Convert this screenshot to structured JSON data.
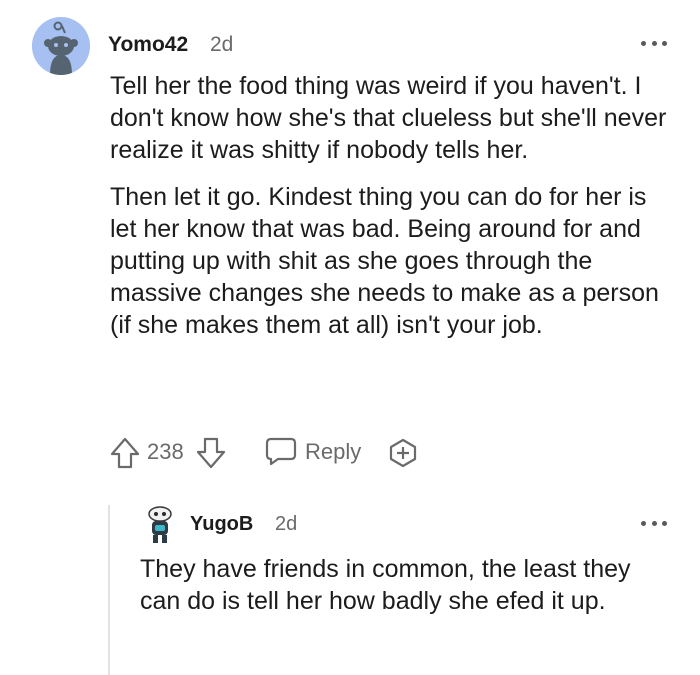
{
  "comment": {
    "author": "Yomo42",
    "age": "2d",
    "paragraphs": [
      "Tell her the food thing was weird if you haven't. I don't know how she's that clueless but she'll never realize it was shitty if nobody tells her.",
      "Then let it go. Kindest thing you can do for her is let her know that was bad. Being around for and putting up with shit as she goes through the massive changes she needs to make as a person (if she makes them at all) isn't your job."
    ],
    "score": "238",
    "reply_label": "Reply"
  },
  "reply": {
    "author": "YugoB",
    "age": "2d",
    "text": "They have friends in common, the least they can do is tell her how badly she efed it up."
  },
  "icons": {
    "upvote": "arrow-up-icon",
    "downvote": "arrow-down-icon",
    "reply": "speech-bubble-icon",
    "award": "award-plus-icon",
    "more": "more-dots-icon"
  },
  "colors": {
    "avatar_bg": "#a7c0f2",
    "text": "#1c1c1c",
    "muted": "#6a6a6a",
    "thread_line": "#e2e2e2"
  }
}
